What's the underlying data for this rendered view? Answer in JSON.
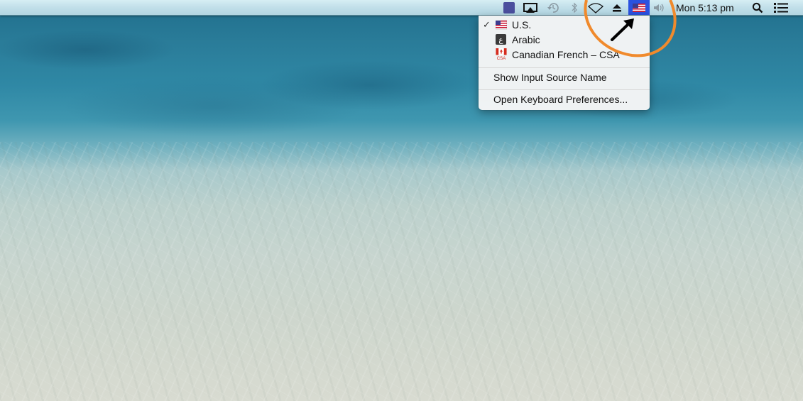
{
  "desktop": {
    "wallpaper": "shallow-sea-water"
  },
  "menubar": {
    "status_items": [
      {
        "id": "app-status",
        "icon": "purple-square-icon"
      },
      {
        "id": "airplay",
        "icon": "airplay-display-icon"
      },
      {
        "id": "time-machine",
        "icon": "time-machine-icon"
      },
      {
        "id": "bluetooth",
        "icon": "bluetooth-icon"
      },
      {
        "id": "wifi",
        "icon": "wifi-icon"
      },
      {
        "id": "eject",
        "icon": "eject-icon"
      },
      {
        "id": "input-source",
        "icon": "us-flag-icon",
        "active": true
      },
      {
        "id": "volume",
        "icon": "volume-icon"
      }
    ],
    "clock": "Mon 5:13 pm",
    "spotlight_icon": "search-icon",
    "notification_icon": "notification-center-icon",
    "colors": {
      "input_source_highlight": "#2a52e0"
    }
  },
  "input_menu": {
    "sources": [
      {
        "label": "U.S.",
        "icon": "us-flag-icon",
        "checked": true,
        "check_glyph": "✓"
      },
      {
        "label": "Arabic",
        "icon": "arabic-keyboard-icon",
        "checked": false,
        "icon_glyph": "ع"
      },
      {
        "label": "Canadian French – CSA",
        "icon": "canada-flag-csa-icon",
        "checked": false,
        "icon_caption": "CSA"
      }
    ],
    "show_input_source_name": "Show Input Source Name",
    "open_keyboard_preferences": "Open Keyboard Preferences..."
  },
  "annotation": {
    "circle_color": "#f08a2c",
    "arrow_color": "#000000"
  }
}
